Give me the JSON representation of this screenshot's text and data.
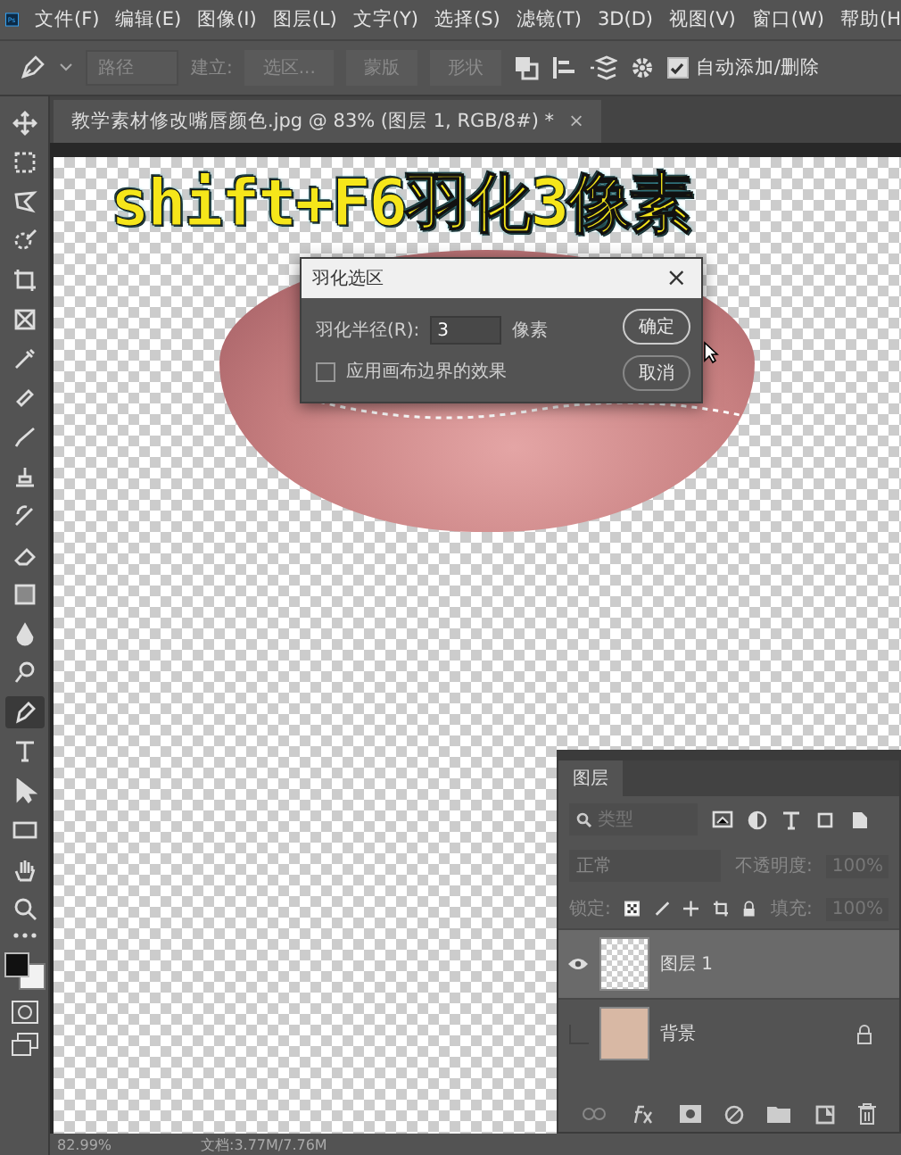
{
  "menu_bar": {
    "logo": "Ps",
    "items": [
      "文件(F)",
      "编辑(E)",
      "图像(I)",
      "图层(L)",
      "文字(Y)",
      "选择(S)",
      "滤镜(T)",
      "3D(D)",
      "视图(V)",
      "窗口(W)",
      "帮助(H"
    ]
  },
  "options_bar": {
    "mode_dropdown": "路径",
    "make_label": "建立:",
    "buttons": [
      "选区...",
      "蒙版",
      "形状"
    ],
    "auto_add_delete": {
      "label": "自动添加/删除",
      "checked": true
    }
  },
  "document_tab": {
    "title": "教学素材修改嘴唇颜色.jpg @ 83% (图层 1, RGB/8#) *",
    "close": "×"
  },
  "toolbar": {
    "tools": [
      {
        "selected": false
      },
      {
        "selected": false
      },
      {
        "selected": false
      },
      {
        "selected": false
      },
      {
        "selected": false
      },
      {
        "selected": false
      },
      {
        "selected": false
      },
      {
        "selected": false
      },
      {
        "selected": false
      },
      {
        "selected": false
      },
      {
        "selected": false
      },
      {
        "selected": false
      },
      {
        "selected": false
      },
      {
        "selected": false
      },
      {
        "selected": false
      },
      {
        "selected": true
      },
      {
        "selected": false
      },
      {
        "selected": false
      },
      {
        "selected": false
      },
      {
        "selected": false
      },
      {
        "selected": false
      }
    ]
  },
  "canvas": {
    "caption": "shift+F6羽化3像素"
  },
  "feather_dialog": {
    "title": "羽化选区",
    "close": "×",
    "radius_label": "羽化半径(R):",
    "radius_value": "3",
    "unit": "像素",
    "ok_button": "确定",
    "cancel_button": "取消",
    "apply_canvas_bounds": {
      "label": "应用画布边界的效果",
      "checked": false
    }
  },
  "layers_panel": {
    "tab": "图层",
    "search_placeholder": "类型",
    "blend_mode": "正常",
    "opacity_label": "不透明度:",
    "opacity_value": "100%",
    "lock_label": "锁定:",
    "fill_label": "填充:",
    "fill_value": "100%",
    "layers": [
      {
        "name": "图层 1",
        "visible": true,
        "selected": true,
        "locked": false,
        "kind": "transparent"
      },
      {
        "name": "背景",
        "visible": false,
        "selected": false,
        "locked": true,
        "kind": "photo"
      }
    ]
  },
  "status_bar": {
    "zoom": "82.99%",
    "doc_size": "文档:3.77M/7.76M"
  }
}
